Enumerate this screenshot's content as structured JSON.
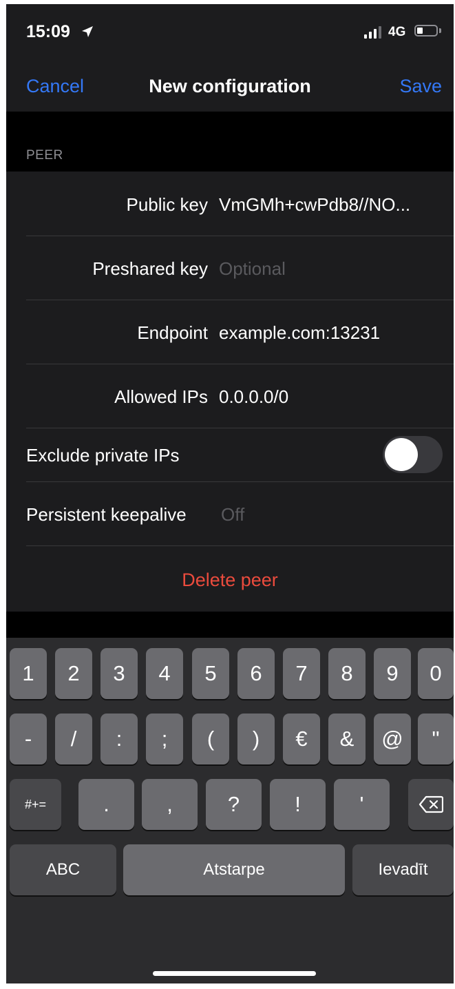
{
  "status_bar": {
    "time": "15:09",
    "network": "4G"
  },
  "nav": {
    "cancel": "Cancel",
    "title": "New configuration",
    "save": "Save"
  },
  "section": {
    "header": "PEER"
  },
  "fields": {
    "public_key": {
      "label": "Public key",
      "value": "VmGMh+cwPdb8//NO..."
    },
    "preshared_key": {
      "label": "Preshared key",
      "placeholder": "Optional"
    },
    "endpoint": {
      "label": "Endpoint",
      "value": "example.com:13231"
    },
    "allowed_ips": {
      "label": "Allowed IPs",
      "value": "0.0.0.0/0"
    },
    "exclude_private_ips": {
      "label": "Exclude private IPs",
      "on": false
    },
    "persistent_keepalive": {
      "label": "Persistent keepalive",
      "placeholder": "Off"
    }
  },
  "actions": {
    "delete_peer": "Delete peer"
  },
  "keyboard": {
    "row1": [
      "1",
      "2",
      "3",
      "4",
      "5",
      "6",
      "7",
      "8",
      "9",
      "0"
    ],
    "row2": [
      "-",
      "/",
      ":",
      ";",
      "(",
      ")",
      "€",
      "&",
      "@",
      "\""
    ],
    "row3_symbols_key": "#+=",
    "row3": [
      ".",
      ",",
      "?",
      "!",
      "'"
    ],
    "abc": "ABC",
    "space": "Atstarpe",
    "return": "Ievadīt"
  },
  "colors": {
    "accent": "#3478f6",
    "destructive": "#eb4b3d",
    "background": "#000000",
    "cell": "#1c1c1e"
  }
}
